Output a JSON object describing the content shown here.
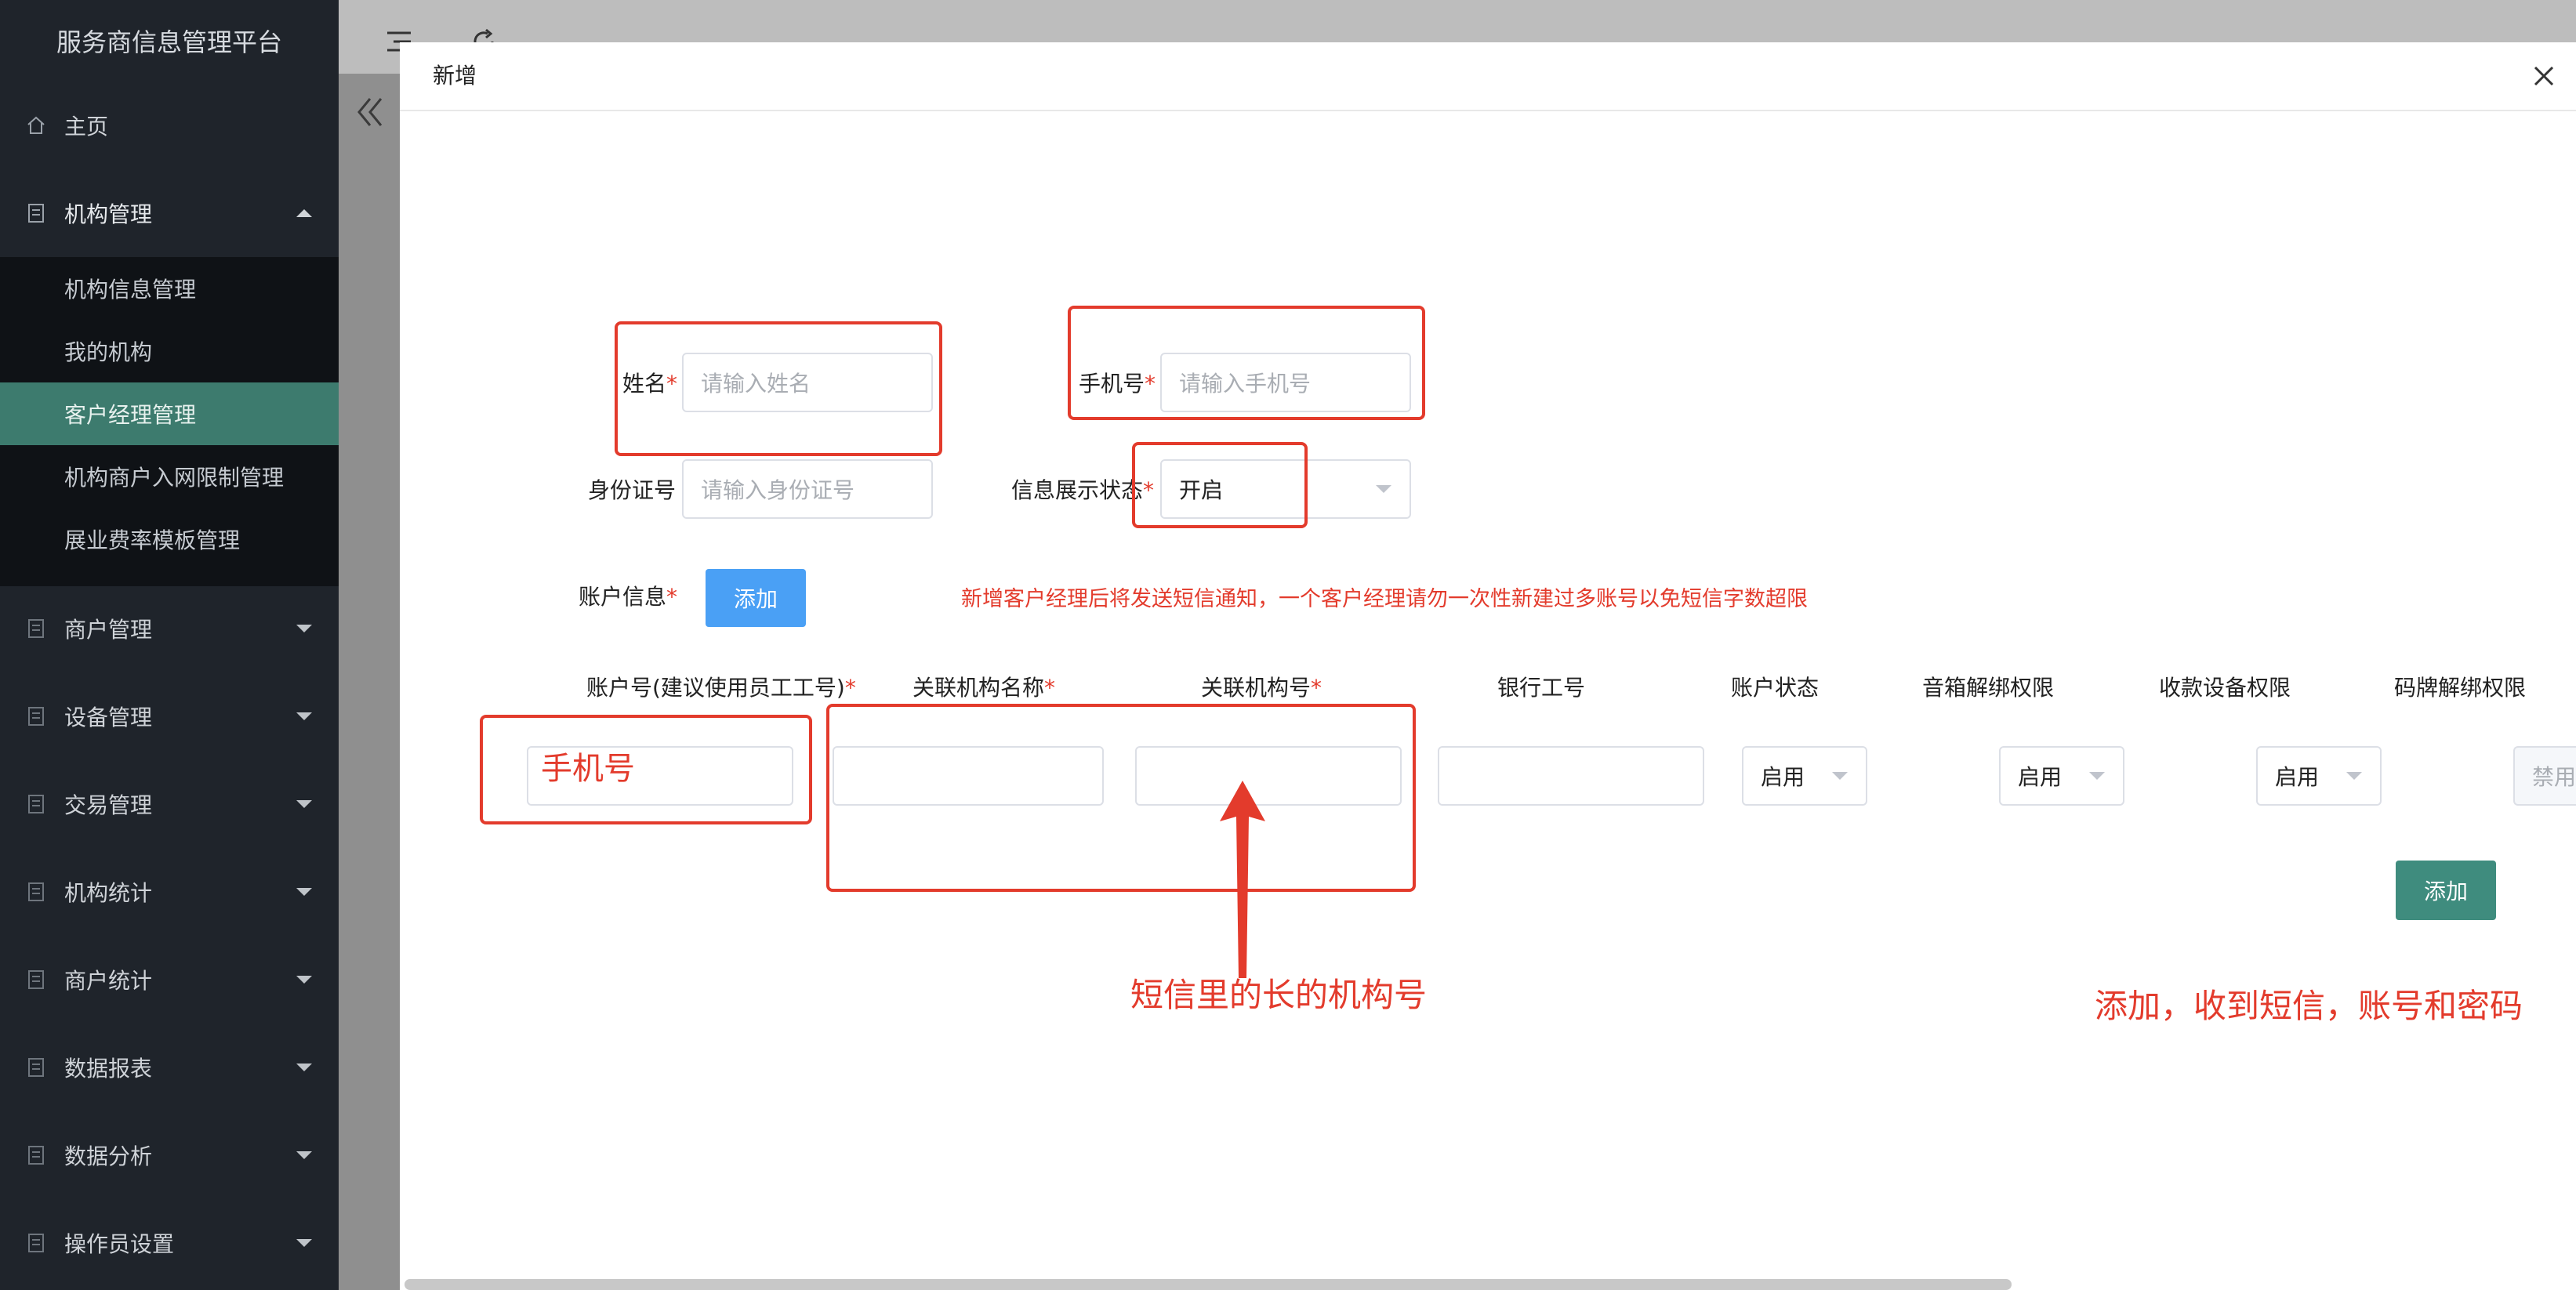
{
  "sidebar": {
    "brand": "服务商信息管理平台",
    "home": "主页",
    "groups": [
      {
        "label": "机构管理"
      },
      {
        "label": "商户管理"
      },
      {
        "label": "设备管理"
      },
      {
        "label": "交易管理"
      },
      {
        "label": "机构统计"
      },
      {
        "label": "商户统计"
      },
      {
        "label": "数据报表"
      },
      {
        "label": "数据分析"
      },
      {
        "label": "操作员设置"
      }
    ],
    "sub_items": [
      {
        "label": "机构信息管理"
      },
      {
        "label": "我的机构"
      },
      {
        "label": "客户经理管理",
        "active": true
      },
      {
        "label": "机构商户入网限制管理"
      },
      {
        "label": "展业费率模板管理"
      }
    ]
  },
  "modal": {
    "title": "新增",
    "form": {
      "name_label": "姓名",
      "name_placeholder": "请输入姓名",
      "phone_label": "手机号",
      "phone_placeholder": "请输入手机号",
      "id_label": "身份证号",
      "id_placeholder": "请输入身份证号",
      "display_status_label": "信息展示状态",
      "display_status_value": "开启",
      "account_info_label": "账户信息",
      "add_button": "添加",
      "notice": "新增客户经理后将发送短信通知，一个客户经理请勿一次性新建过多账号以免短信字数超限"
    },
    "table": {
      "columns": [
        "账户号(建议使用员工工号)",
        "关联机构名称",
        "关联机构号",
        "银行工号",
        "账户状态",
        "音箱解绑权限",
        "收款设备权限",
        "码牌解绑权限"
      ],
      "required": [
        true,
        true,
        true,
        false,
        false,
        false,
        false,
        false
      ],
      "row": {
        "account_status": "启用",
        "speaker_unbind": "启用",
        "device_permission": "启用",
        "qr_unbind": "禁用"
      }
    },
    "row_add_button": "添加"
  },
  "annotations": {
    "phone_hint": "手机号",
    "org_hint": "短信里的长的机构号",
    "add_hint": "添加，收到短信，账号和密码"
  },
  "colors": {
    "sidebar_bg": "#1f242b",
    "active_bg": "#3d7b6e",
    "primary_blue": "#4aa0f5",
    "primary_green": "#3f8c7e",
    "annotation_red": "#e33b2c"
  }
}
